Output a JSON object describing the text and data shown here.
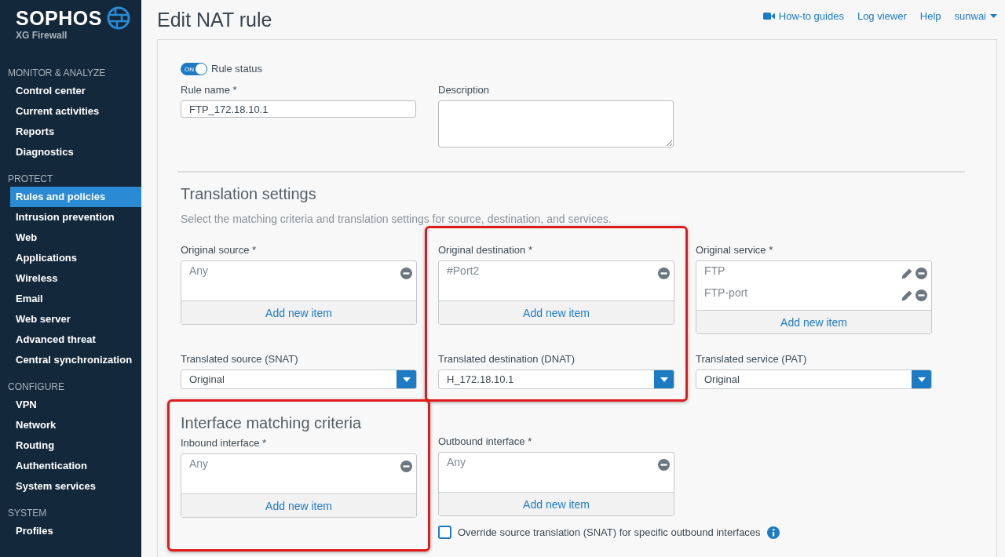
{
  "sidebar": {
    "brand": "SOPHOS",
    "product": "XG Firewall",
    "sections": [
      {
        "heading": "MONITOR & ANALYZE",
        "items": [
          {
            "label": "Control center",
            "selected": false
          },
          {
            "label": "Current activities",
            "selected": false
          },
          {
            "label": "Reports",
            "selected": false
          },
          {
            "label": "Diagnostics",
            "selected": false
          }
        ]
      },
      {
        "heading": "PROTECT",
        "items": [
          {
            "label": "Rules and policies",
            "selected": true
          },
          {
            "label": "Intrusion prevention",
            "selected": false
          },
          {
            "label": "Web",
            "selected": false
          },
          {
            "label": "Applications",
            "selected": false
          },
          {
            "label": "Wireless",
            "selected": false
          },
          {
            "label": "Email",
            "selected": false
          },
          {
            "label": "Web server",
            "selected": false
          },
          {
            "label": "Advanced threat",
            "selected": false
          },
          {
            "label": "Central synchronization",
            "selected": false
          }
        ]
      },
      {
        "heading": "CONFIGURE",
        "items": [
          {
            "label": "VPN",
            "selected": false
          },
          {
            "label": "Network",
            "selected": false
          },
          {
            "label": "Routing",
            "selected": false
          },
          {
            "label": "Authentication",
            "selected": false
          },
          {
            "label": "System services",
            "selected": false
          }
        ]
      },
      {
        "heading": "SYSTEM",
        "items": [
          {
            "label": "Profiles",
            "selected": false
          }
        ]
      }
    ]
  },
  "header": {
    "title": "Edit NAT rule",
    "links": [
      {
        "label": "How-to guides",
        "kind": "video"
      },
      {
        "label": "Log viewer",
        "kind": "plain"
      },
      {
        "label": "Help",
        "kind": "plain"
      },
      {
        "label": "sunwai",
        "kind": "menu"
      }
    ]
  },
  "rule_status": {
    "on": true,
    "switch_text": "ON",
    "label": "Rule status"
  },
  "rule_name": {
    "label": "Rule name *",
    "value": "FTP_172.18.10.1"
  },
  "description": {
    "label": "Description"
  },
  "translation": {
    "heading": "Translation settings",
    "subtitle": "Select the matching criteria and translation settings for source, destination, and services.",
    "columns": [
      {
        "highlighted": false,
        "original": {
          "label": "Original source *",
          "items": [
            {
              "text": "Any",
              "editable": false
            }
          ],
          "add_label": "Add new item"
        },
        "translated": {
          "label": "Translated source (SNAT)",
          "value": "Original"
        }
      },
      {
        "highlighted": true,
        "original": {
          "label": "Original destination *",
          "items": [
            {
              "text": "#Port2",
              "editable": false
            }
          ],
          "add_label": "Add new item"
        },
        "translated": {
          "label": "Translated destination (DNAT)",
          "value": "H_172.18.10.1"
        }
      },
      {
        "highlighted": false,
        "original": {
          "label": "Original service *",
          "items": [
            {
              "text": "FTP",
              "editable": true
            },
            {
              "text": "FTP-port",
              "editable": true
            }
          ],
          "add_label": "Add new item"
        },
        "translated": {
          "label": "Translated service (PAT)",
          "value": "Original"
        }
      }
    ]
  },
  "interface": {
    "heading": "Interface matching criteria",
    "highlighted": true,
    "inbound": {
      "label": "Inbound interface *",
      "items": [
        {
          "text": "Any",
          "editable": false
        }
      ],
      "add_label": "Add new item"
    },
    "outbound": {
      "label": "Outbound interface *",
      "items": [
        {
          "text": "Any",
          "editable": false
        }
      ],
      "add_label": "Add new item"
    },
    "override": {
      "label": "Override source translation (SNAT) for specific outbound interfaces",
      "checked": false
    }
  }
}
